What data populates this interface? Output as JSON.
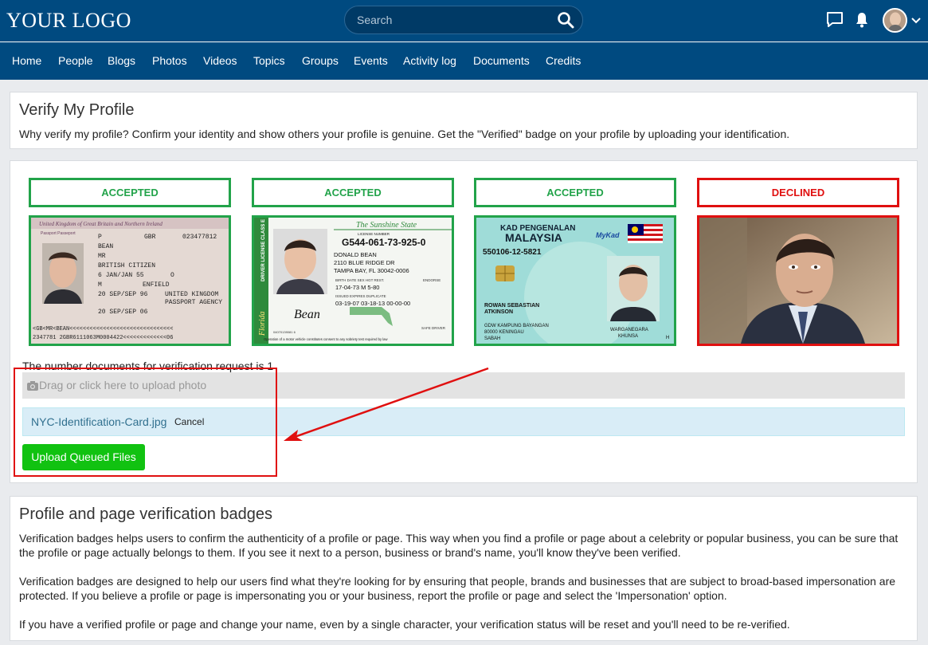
{
  "header": {
    "logo": "YOUR LOGO",
    "search_placeholder": "Search",
    "icons": [
      "search-icon",
      "chat-icon",
      "bell-icon",
      "avatar",
      "chevron-down-icon"
    ]
  },
  "nav": {
    "items": [
      "Home",
      "People",
      "Blogs",
      "Photos",
      "Videos",
      "Topics",
      "Groups",
      "Events",
      "Activity log",
      "Documents",
      "Credits"
    ]
  },
  "verify": {
    "title": "Verify My Profile",
    "description": "Why verify my profile? Confirm your identity and show others your profile is genuine. Get the \"Verified\" badge on your profile by uploading your identification."
  },
  "documents": {
    "items": [
      {
        "status": "ACCEPTED",
        "color": "#22a34a",
        "text": {
          "header": "United Kingdom of Great Britain and Northern Ireland",
          "sub": "Passport Passeport",
          "l1": "P",
          "l1b": "GBR",
          "l1c": "023477812",
          "l2": "BEAN",
          "l3": "MR",
          "l4": "BRITISH CITIZEN",
          "l5": "6 JAN/JAN 55",
          "l5b": "O",
          "l6": "M",
          "l6b": "ENFIELD",
          "l7": "20 SEP/SEP 96",
          "l7b": "UNITED KINGDOM",
          "l7c": "PASSPORT AGENCY",
          "l8": "20 SEP/SEP 06",
          "mrz1": "<GB<MR<BEAN<<<<<<<<<<<<<<<<<<<<<<<<<<<<<<<",
          "mrz2": "2347781 2GBR6111063M0004422<<<<<<<<<<<<<06"
        }
      },
      {
        "status": "ACCEPTED",
        "color": "#22a34a",
        "text": {
          "state": "The Sunshine State",
          "license_label": "LICENSE NUMBER",
          "number": "G544-061-73-925-0",
          "name": "DONALD BEAN",
          "addr1": "2110 BLUE RIDGE DR",
          "addr2": "TAMPA BAY, FL 30042-0006",
          "side": "DRIVER LICENSE CLASS E",
          "florida": "Florida",
          "hdr1": "BIRTH DATE  SEX  HGT  REST.",
          "endorse": "ENDORSE",
          "row1": "17-04-73 M  5-80",
          "hdr2": "ISSUED        EXPIRES     DUPLICATE",
          "row2": "03-19-07   03-18-13   00-00-00",
          "sig": "Bean",
          "safe": "SAFE DRIVER",
          "serial": "04070139081 6",
          "consent": "Operation of a motor vehicle constitutes consent to any sobriety test required by law"
        }
      },
      {
        "status": "ACCEPTED",
        "color": "#22a34a",
        "text": {
          "kad": "KAD PENGENALAN",
          "malaysia": "MALAYSIA",
          "mykad": "MyKad",
          "number": "550106-12-5821",
          "name1": "ROWAN SEBASTIAN",
          "name2": "ATKINSON",
          "addr1": "GDW KAMPUNG BAYANGAN",
          "addr2": "80000 KENINGAU",
          "addr3": "SABAH",
          "warga1": "WARGANEGARA",
          "warga2": "KHUNSA",
          "h": "H"
        }
      },
      {
        "status": "DECLINED",
        "color": "#e01010"
      }
    ]
  },
  "request_count_text": "The number documents for verification request is 1",
  "upload": {
    "dropzone_text": "Drag or click here to upload photo",
    "queued_file": "NYC-Identification-Card.jpg",
    "cancel_label": "Cancel",
    "button_label": "Upload Queued Files"
  },
  "badges": {
    "title": "Profile and page verification badges",
    "p1": "Verification badges helps users to confirm the authenticity of a profile or page. This way when you find a profile or page about a celebrity or popular business, you can be sure that the profile or page actually belongs to them. If you see it next to a person, business or brand's name, you'll know they've been verified.",
    "p2": "Verification badges are designed to help our users find what they're looking for by ensuring that people, brands and businesses that are subject to broad-based impersonation are protected. If you believe a profile or page is impersonating you or your business, report the profile or page and select the 'Impersonation' option.",
    "p3": "If you have a verified profile or page and change your name, even by a single character, your verification status will be reset and you'll need to be re-verified."
  },
  "colors": {
    "header_bg": "#004a80",
    "accepted": "#22a34a",
    "declined": "#e01010",
    "upload_button": "#11c211",
    "annotation": "#e01010"
  }
}
